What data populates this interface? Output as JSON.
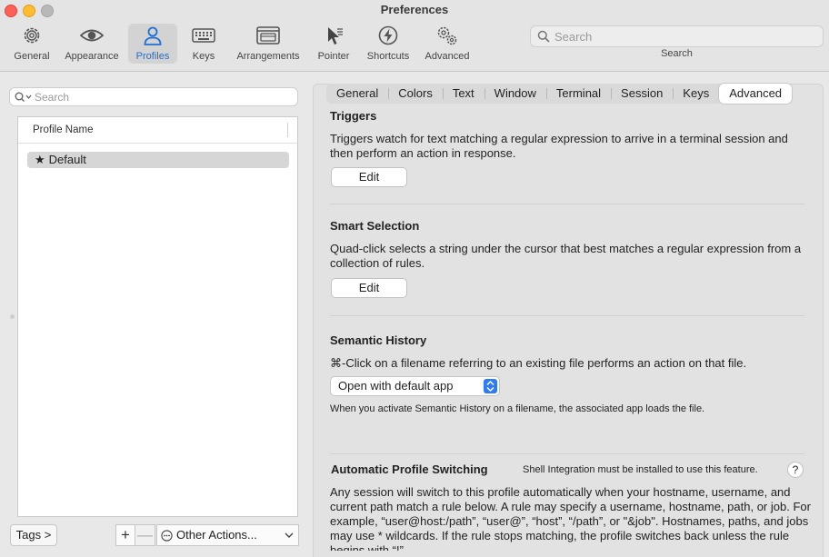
{
  "window": {
    "title": "Preferences"
  },
  "toolbar": {
    "items": [
      {
        "label": "General",
        "icon": "gear-icon"
      },
      {
        "label": "Appearance",
        "icon": "eye-icon"
      },
      {
        "label": "Profiles",
        "icon": "person-icon"
      },
      {
        "label": "Keys",
        "icon": "keyboard-icon"
      },
      {
        "label": "Arrangements",
        "icon": "windows-icon"
      },
      {
        "label": "Pointer",
        "icon": "pointer-icon"
      },
      {
        "label": "Shortcuts",
        "icon": "bolt-icon"
      },
      {
        "label": "Advanced",
        "icon": "gears-icon"
      }
    ],
    "active": "Profiles",
    "search_placeholder": "Search",
    "search_label": "Search"
  },
  "profiles": {
    "search_placeholder": "Search",
    "column_header": "Profile Name",
    "rows": [
      {
        "star": "★",
        "name": "Default"
      }
    ],
    "tags_label": "Tags >",
    "plus_label": "+",
    "minus_label": "—",
    "other_actions_label": "Other Actions..."
  },
  "tabs": [
    "General",
    "Colors",
    "Text",
    "Window",
    "Terminal",
    "Session",
    "Keys",
    "Advanced"
  ],
  "active_tab": "Advanced",
  "triggers": {
    "title": "Triggers",
    "description": "Triggers watch for text matching a regular expression to arrive in a terminal session and then perform an action in response.",
    "button": "Edit"
  },
  "smart_selection": {
    "title": "Smart Selection",
    "description": "Quad-click selects a string under the cursor that best matches a regular expression from a collection of rules.",
    "button": "Edit"
  },
  "semantic_history": {
    "title": "Semantic History",
    "description": "⌘-Click on a filename referring to an existing file performs an action on that file.",
    "selected_option": "Open with default app",
    "note": "When you activate Semantic History on a filename, the associated app loads the file."
  },
  "auto_profile_switching": {
    "title": "Automatic Profile Switching",
    "note": "Shell Integration must be installed to use this feature.",
    "help": "?",
    "description": "Any session will switch to this profile automatically when your hostname, username, and current path match a rule below. A rule may specify a username, hostname, path, or job. For example, “user@host:/path”, “user@”, “host”, “/path”, or \"&job\". Hostnames, paths, and jobs may use * wildcards. If the rule stops matching, the profile switches back unless the rule begins with “!”."
  },
  "colors": {
    "accent": "#1f6fd8",
    "popup_stepper": "#2f7bf5"
  }
}
